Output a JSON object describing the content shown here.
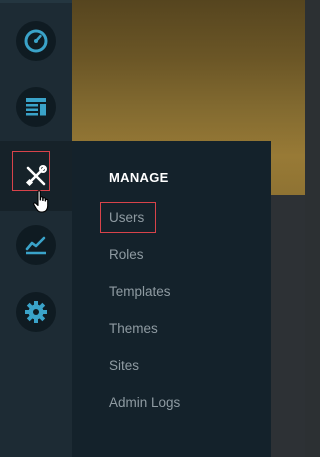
{
  "banner": {
    "colors": [
      "#56451f",
      "#987a36"
    ]
  },
  "rail": {
    "items": [
      {
        "icon": "speedometer-icon"
      },
      {
        "icon": "newspaper-icon"
      },
      {
        "icon": "tools-icon",
        "active": true
      },
      {
        "icon": "chart-line-icon"
      },
      {
        "icon": "gear-icon"
      }
    ],
    "accent_color": "#d8434a"
  },
  "flyout": {
    "title": "MANAGE",
    "items": [
      {
        "label": "Users",
        "highlighted": true
      },
      {
        "label": "Roles"
      },
      {
        "label": "Templates"
      },
      {
        "label": "Themes"
      },
      {
        "label": "Sites"
      },
      {
        "label": "Admin Logs"
      }
    ]
  }
}
